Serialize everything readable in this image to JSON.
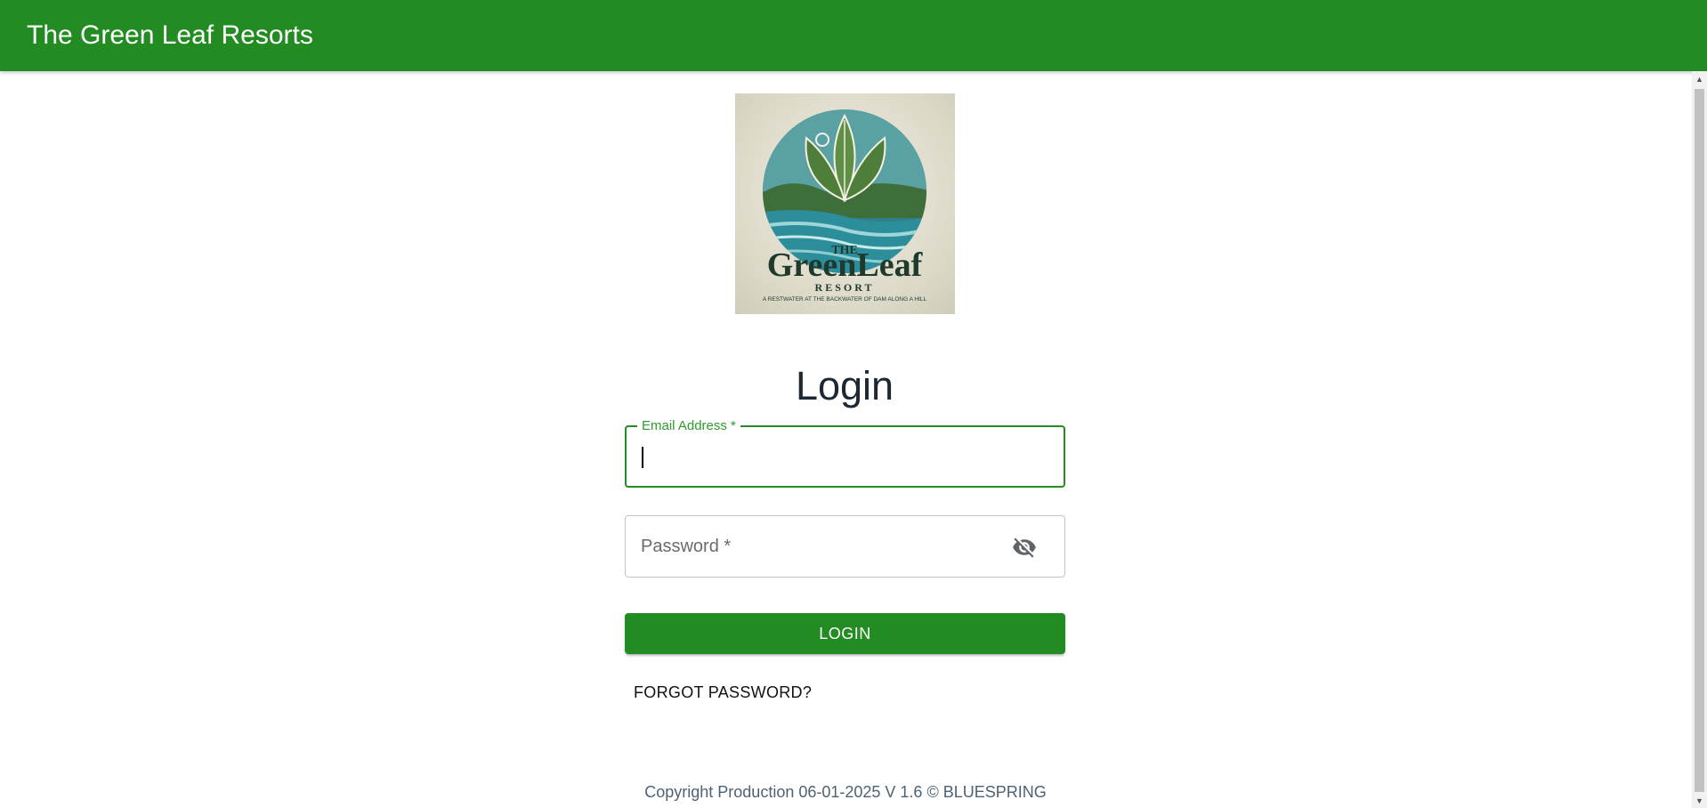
{
  "appbar": {
    "title": "The Green Leaf Resorts"
  },
  "logo": {
    "line1": "THE",
    "line2": "GreenLeaf",
    "line3": "RESORT",
    "tagline": "A RESTWATER AT THE BACKWATER OF DAM ALONG A HILL"
  },
  "login": {
    "title": "Login",
    "email_label": "Email Address *",
    "email_value": "",
    "password_placeholder": "Password *",
    "password_toggle_icon": "visibility-off-icon",
    "login_button": "LOGIN",
    "forgot_password": "FORGOT PASSWORD?"
  },
  "footer": {
    "text": "Copyright Production 06-01-2025 V 1.6 © BLUESPRING"
  },
  "colors": {
    "brand": "#228b22",
    "title": "#1c2833",
    "footer": "#4e6272"
  }
}
